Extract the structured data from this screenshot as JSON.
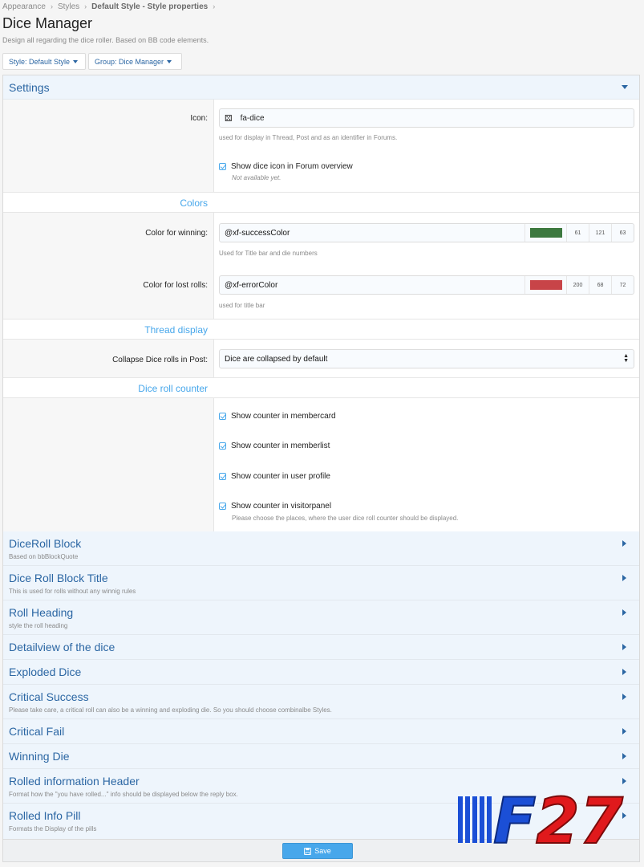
{
  "breadcrumb": [
    "Appearance",
    "Styles",
    "Default Style - Style properties"
  ],
  "page_title": "Dice Manager",
  "page_description": "Design all regarding the dice roller. Based on BB code elements.",
  "filters": {
    "style": "Style: Default Style",
    "group": "Group: Dice Manager"
  },
  "settings": {
    "header": "Settings",
    "icon_label": "Icon:",
    "icon_value": "fa-dice",
    "icon_hint": "used for display in Thread, Post and as an identifier in Forums.",
    "show_dice_icon_label": "Show dice icon in Forum overview",
    "show_dice_icon_hint": "Not available yet."
  },
  "colors": {
    "subheading": "Colors",
    "winning_label": "Color for winning:",
    "winning_value": "@xf-successColor",
    "winning_rgb": [
      "61",
      "121",
      "63"
    ],
    "winning_hex": "#3d793f",
    "winning_hint": "Used for Title bar and die numbers",
    "lost_label": "Color for lost rolls:",
    "lost_value": "@xf-errorColor",
    "lost_rgb": [
      "200",
      "68",
      "72"
    ],
    "lost_hex": "#c84448",
    "lost_hint": "used for title bar"
  },
  "thread_display": {
    "subheading": "Thread display",
    "collapse_label": "Collapse Dice rolls in Post:",
    "collapse_value": "Dice are collapsed by default"
  },
  "counter": {
    "subheading": "Dice roll counter",
    "items": [
      "Show counter in membercard",
      "Show counter in memberlist",
      "Show counter in user profile",
      "Show counter in visitorpanel"
    ],
    "hint": "Please choose the places, where the user dice roll counter should be displayed."
  },
  "sections": [
    {
      "title": "DiceRoll Block",
      "sub": "Based on bbBlockQuote"
    },
    {
      "title": "Dice Roll Block Title",
      "sub": "This is used for rolls without any winnig rules"
    },
    {
      "title": "Roll Heading",
      "sub": "style the roll heading"
    },
    {
      "title": "Detailview of the dice",
      "sub": ""
    },
    {
      "title": "Exploded Dice",
      "sub": ""
    },
    {
      "title": "Critical Success",
      "sub": "Please take care, a critical roll can also be a winning and exploding die. So you should choose combinalbe Styles."
    },
    {
      "title": "Critical Fail",
      "sub": ""
    },
    {
      "title": "Winning Die",
      "sub": ""
    },
    {
      "title": "Rolled information Header",
      "sub": "Format how the \"you have rolled...\" info should be displayed below the reply box."
    },
    {
      "title": "Rolled Info Pill",
      "sub": "Formats the Display of the pills"
    }
  ],
  "save_label": "Save",
  "logo_text": "F27"
}
